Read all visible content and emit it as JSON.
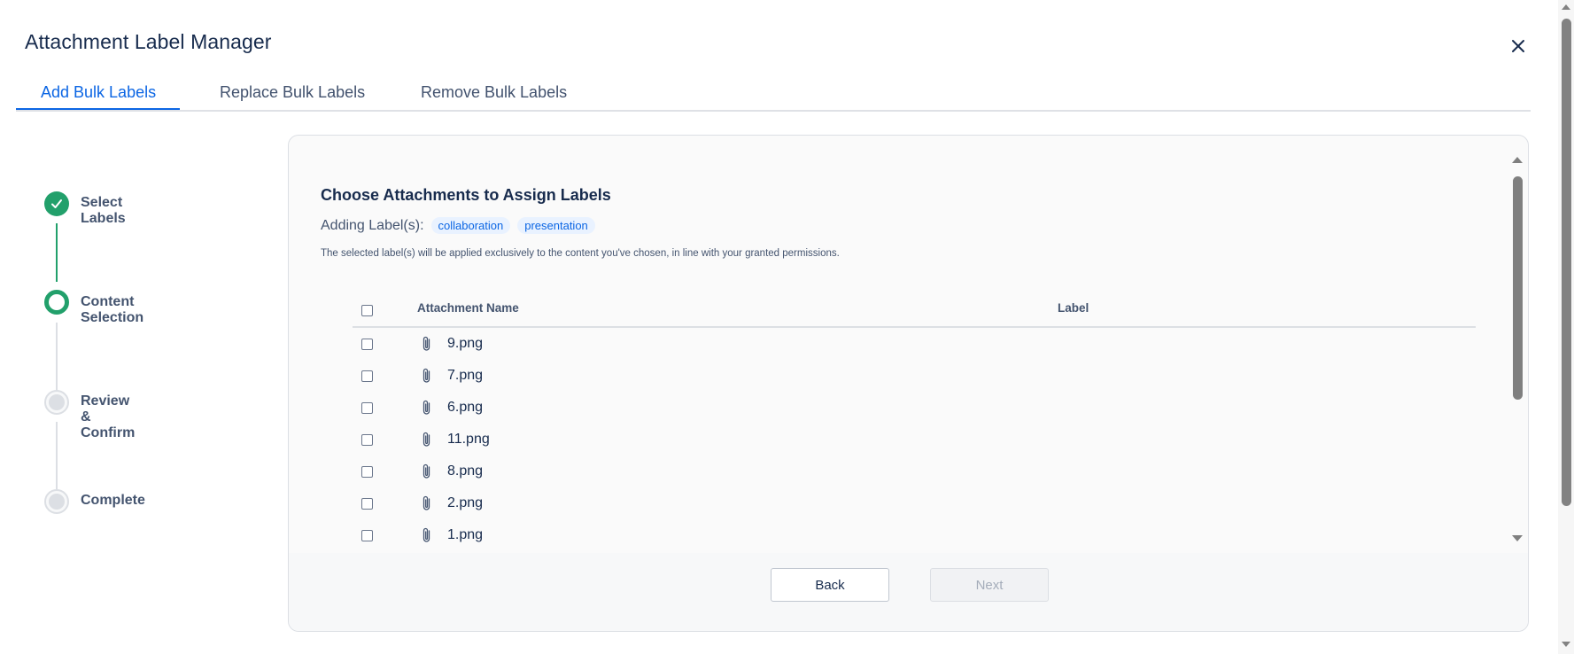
{
  "dialog": {
    "title": "Attachment Label Manager"
  },
  "tabs": [
    {
      "label": "Add Bulk Labels",
      "active": true
    },
    {
      "label": "Replace Bulk Labels",
      "active": false
    },
    {
      "label": "Remove Bulk Labels",
      "active": false
    }
  ],
  "steps": [
    {
      "label": "Select Labels",
      "status": "complete"
    },
    {
      "label": "Content Selection",
      "status": "current"
    },
    {
      "label": "Review & Confirm",
      "status": "pending"
    },
    {
      "label": "Complete",
      "status": "pending"
    }
  ],
  "panel": {
    "title": "Choose Attachments to Assign Labels",
    "adding_prefix": "Adding Label(s):",
    "labels": [
      "collaboration",
      "presentation"
    ],
    "note": "The selected label(s) will be applied exclusively to the content you've chosen, in line with your granted permissions."
  },
  "table": {
    "headers": {
      "name": "Attachment Name",
      "label": "Label"
    },
    "rows": [
      {
        "name": "9.png",
        "label": ""
      },
      {
        "name": "7.png",
        "label": ""
      },
      {
        "name": "6.png",
        "label": ""
      },
      {
        "name": "11.png",
        "label": ""
      },
      {
        "name": "8.png",
        "label": ""
      },
      {
        "name": "2.png",
        "label": ""
      },
      {
        "name": "1.png",
        "label": ""
      }
    ]
  },
  "footer": {
    "back_label": "Back",
    "next_label": "Next",
    "next_disabled": true
  },
  "colors": {
    "accent": "#0c66e4",
    "success": "#22a06b",
    "chip_bg": "#e9f2ff"
  }
}
